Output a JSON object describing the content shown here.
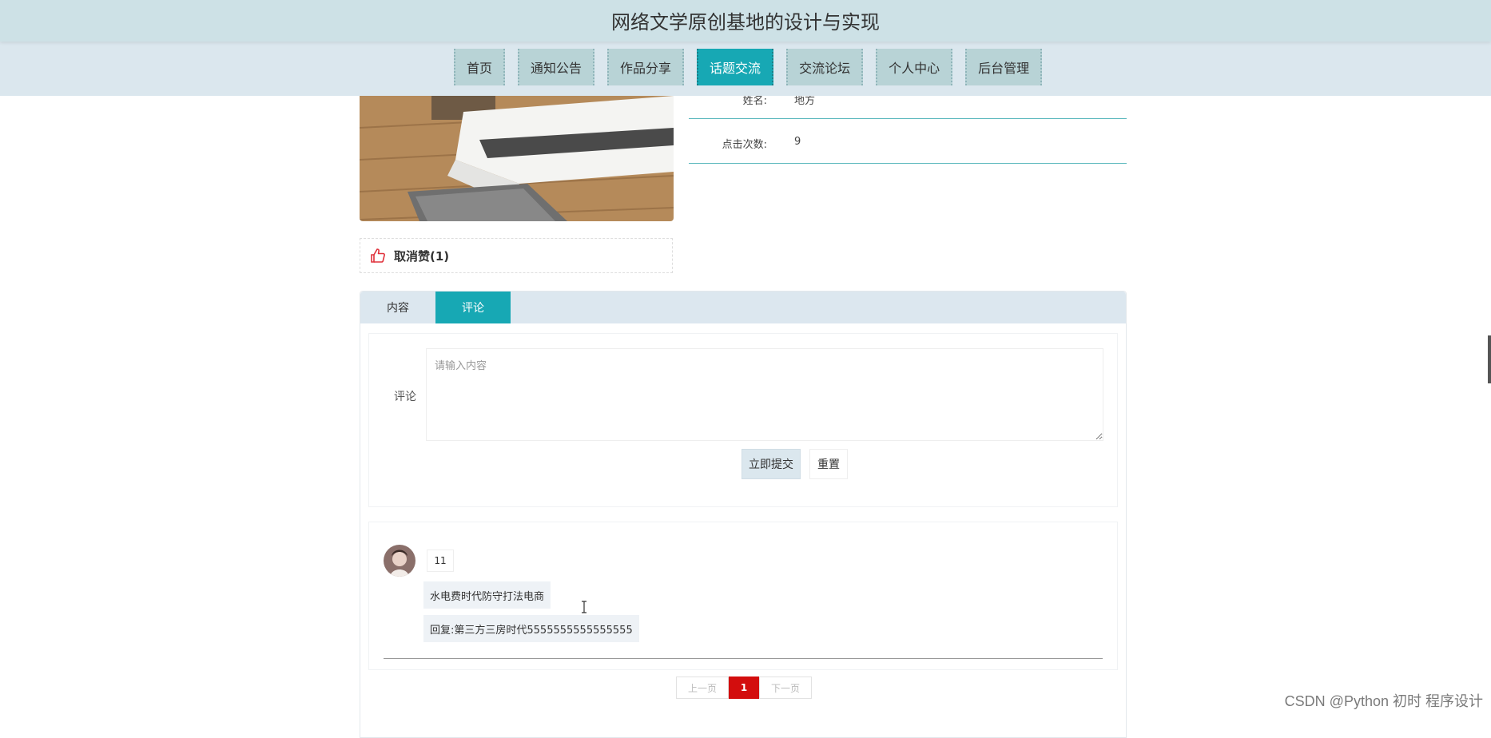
{
  "site": {
    "title": "网络文学原创基地的设计与实现"
  },
  "nav": {
    "items": [
      {
        "label": "首页"
      },
      {
        "label": "通知公告"
      },
      {
        "label": "作品分享"
      },
      {
        "label": "话题交流",
        "active": true
      },
      {
        "label": "交流论坛"
      },
      {
        "label": "个人中心"
      },
      {
        "label": "后台管理"
      }
    ]
  },
  "detail": {
    "name_label": "姓名:",
    "name_value": "地方",
    "clicks_label": "点击次数:",
    "clicks_value": "9"
  },
  "like": {
    "label": "取消赞(1)"
  },
  "tabs": [
    {
      "label": "内容"
    },
    {
      "label": "评论",
      "active": true
    }
  ],
  "comment_form": {
    "label": "评论",
    "placeholder": "请输入内容",
    "submit_label": "立即提交",
    "reset_label": "重置"
  },
  "comments": [
    {
      "user": "11",
      "text": "水电费时代防守打法电商",
      "reply": "回复:第三方三房时代5555555555555555"
    }
  ],
  "pagination": {
    "prev_label": "上一页",
    "current": "1",
    "next_label": "下一页"
  },
  "watermark": "CSDN @Python 初时 程序设计",
  "colors": {
    "accent": "#17a8b4",
    "page_current": "#d30d0d",
    "header_bg": "#cde1e6"
  }
}
